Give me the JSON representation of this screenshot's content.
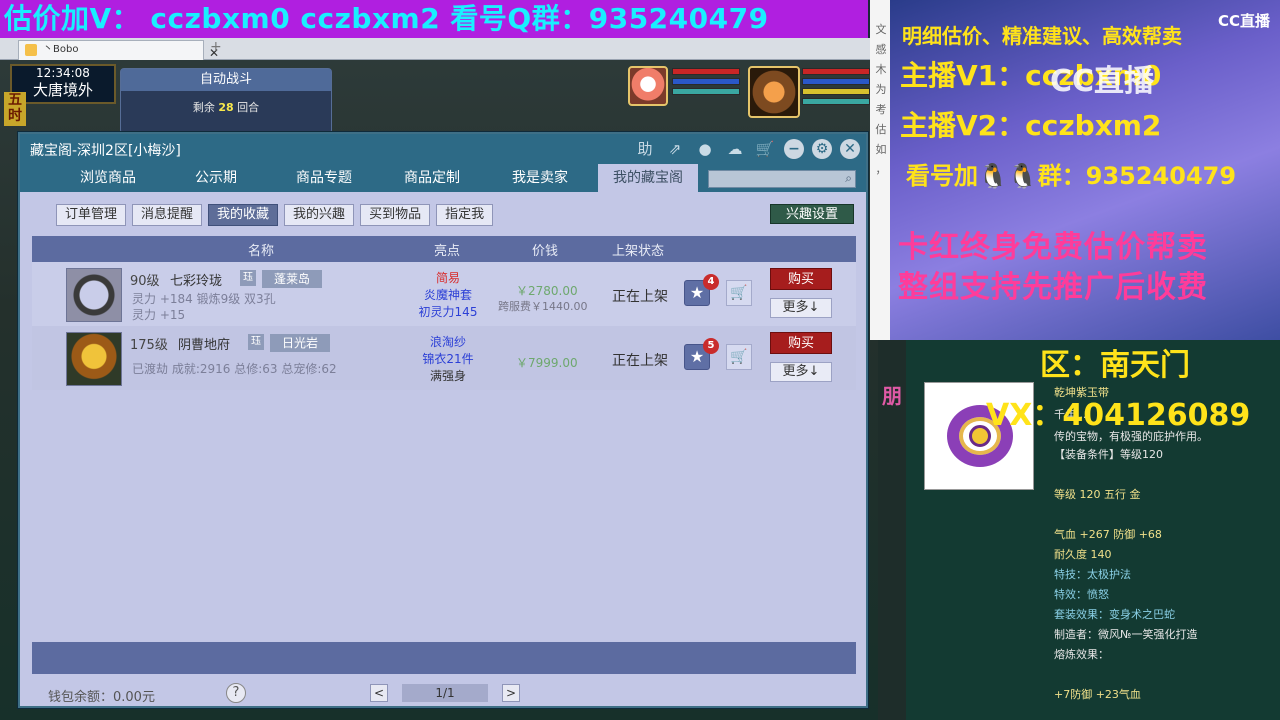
{
  "banner": {
    "text": "估价加V：  cczbxm0    cczbxm2    看号Q群：935240479"
  },
  "browser_tab": {
    "title": "丶Bobo",
    "close": "✕",
    "new_tab": "+"
  },
  "game_hud": {
    "time": "12:34:08",
    "location": "大唐境外",
    "left_tag": "五时",
    "auto_battle": {
      "title": "自动战斗",
      "remaining_prefix": "剩余",
      "remaining_count": "28",
      "remaining_suffix": "回合"
    }
  },
  "window": {
    "title": "藏宝阁-深圳2区[小梅沙]",
    "tools": {
      "help": "助",
      "pin": "⇗",
      "record": "●",
      "chat": "☁",
      "cart": "🛒"
    },
    "controls": {
      "minimize": "−",
      "settings": "⚙",
      "close": "✕"
    },
    "nav_tabs": [
      "浏览商品",
      "公示期",
      "商品专题",
      "商品定制",
      "我是卖家",
      "我的藏宝阁"
    ],
    "active_tab": 5,
    "search_placeholder": "",
    "sub_buttons": [
      "订单管理",
      "消息提醒",
      "我的收藏",
      "我的兴趣",
      "买到物品",
      "指定我"
    ],
    "active_sub": 2,
    "interest_button": "兴趣设置",
    "columns": {
      "name": "名称",
      "highlight": "亮点",
      "price": "价钱",
      "status": "上架状态"
    },
    "rows": [
      {
        "level": "90级",
        "name": "七彩玲珑",
        "tag": "珏",
        "badge": "蓬莱岛",
        "attr1": "灵力 +184  锻炼9级  双3孔",
        "attr2": "灵力 +15",
        "highlights": [
          {
            "text": "简易",
            "color": "#d82a2a"
          },
          {
            "text": "炎魔神套",
            "color": "#2b3fd6"
          },
          {
            "text": "初灵力145",
            "color": "#2b3fd6"
          }
        ],
        "price": "￥2780.00",
        "fee": "跨服费￥1440.00",
        "status": "正在上架",
        "fav_count": "4",
        "buy": "购买",
        "more": "更多↓"
      },
      {
        "level": "175级",
        "name": "阴曹地府",
        "tag": "珏",
        "badge": "日光岩",
        "attr1": "已渡劫  成就:2916  总修:63  总宠修:62",
        "attr2": "",
        "highlights": [
          {
            "text": "浪淘纱",
            "color": "#2b3fd6"
          },
          {
            "text": "锦衣21件",
            "color": "#2b3fd6"
          },
          {
            "text": "满强身",
            "color": "#333333"
          }
        ],
        "price": "￥7999.00",
        "fee": "",
        "status": "正在上架",
        "fav_count": "5",
        "buy": "购买",
        "more": "更多↓"
      }
    ],
    "wallet": "钱包余额：0.00元",
    "help_icon": "?",
    "pagination": {
      "prev": "<",
      "page": "1/1",
      "next": ">"
    }
  },
  "chat_strip": [
    "文",
    "感",
    "木",
    "为",
    "考",
    "估",
    "如",
    "，"
  ],
  "promo": {
    "logo": "CC直播",
    "line1": "明细估价、精准建议、高效帮卖",
    "line2": "主播V1：cczbxm0",
    "line3": "主播V2：cczbxm2",
    "line4": "看号加🐧🐧群：935240479",
    "line5": "卡红终身免费估价帮卖",
    "line6": "整组支持先推广后收费",
    "watermark": "CC直播"
  },
  "tooltip": {
    "left_char": "朋",
    "region": "区：南天门",
    "vx": "VX：404126089",
    "item_name": "乾坤紫玉带",
    "desc1": "千年...",
    "desc2": "传的宝物，有极强的庇护作用。",
    "requirement": "【装备条件】等级120",
    "level_line": "等级 120  五行 金",
    "stats": "气血 +267  防御 +68",
    "durability": "耐久度 140",
    "skill": "特技：太极护法",
    "effect": "特效：愤怒",
    "set": "套装效果：变身术之巴蛇",
    "maker": "制造者：微风№一笑强化打造",
    "smelt_label": "熔炼效果：",
    "smelt": "+7防御 +23气血"
  }
}
